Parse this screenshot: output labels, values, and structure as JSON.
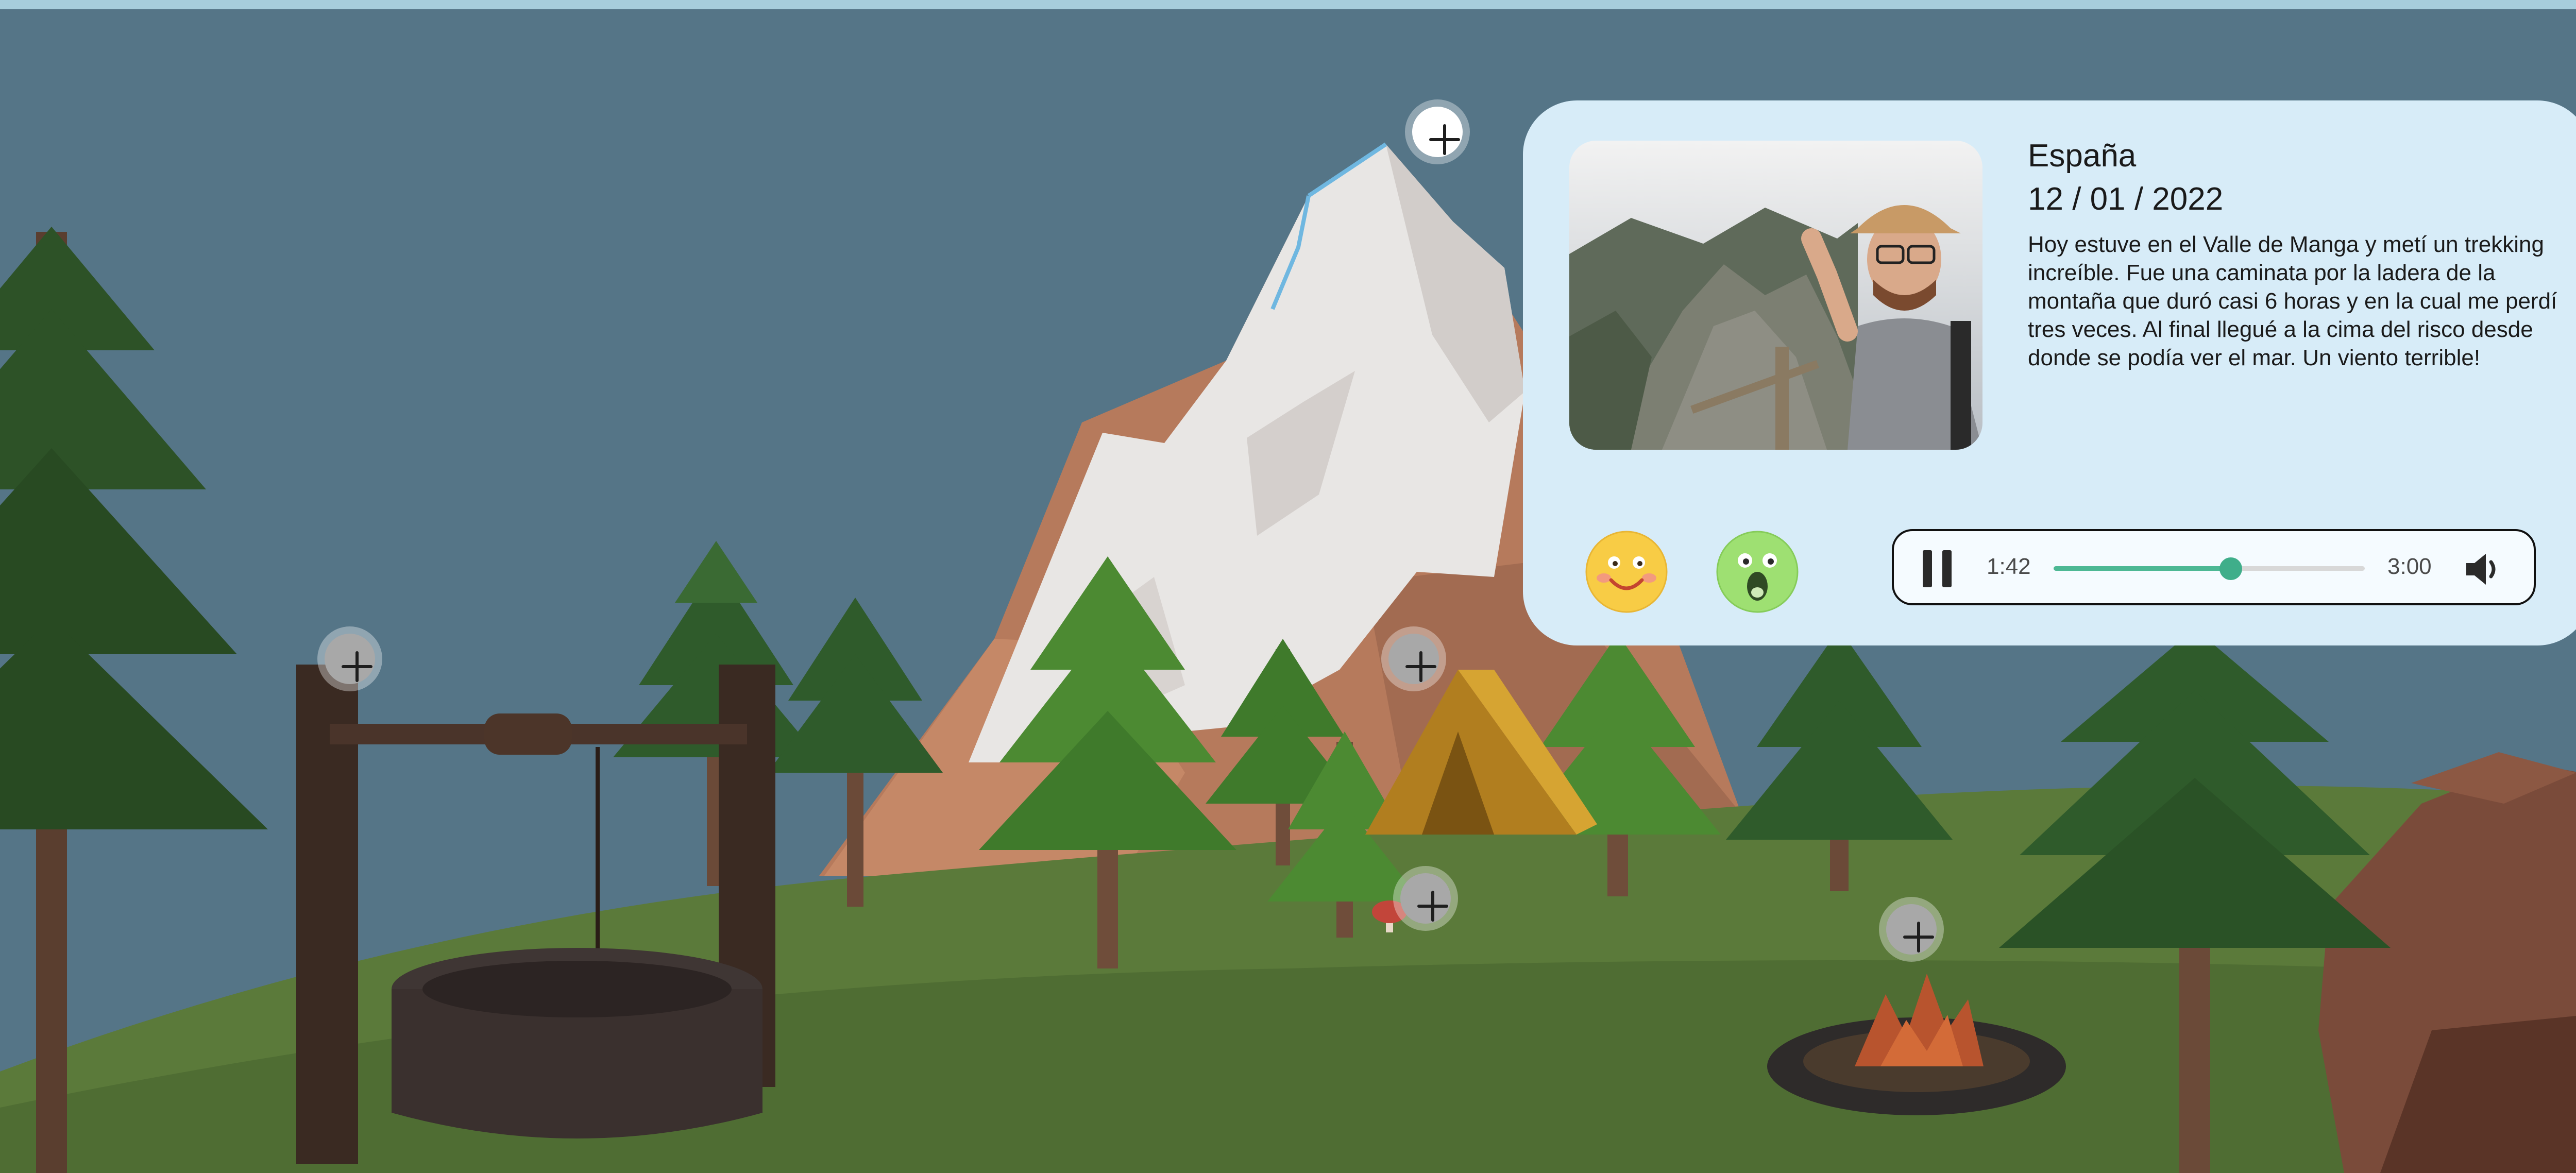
{
  "entry": {
    "country": "España",
    "date": "12 / 01 / 2022",
    "story": "Hoy estuve en el Valle de Manga y metí un trekking increíble. Fue una caminata por la ladera de la montaña que duró casi 6 horas y en la cual me perdí tres veces. Al final llegué a la cima del risco desde donde se podía ver el mar. Un viento terrible!"
  },
  "reactions": [
    {
      "name": "happy-face-icon",
      "color": "#f8cc45"
    },
    {
      "name": "shocked-face-icon",
      "color": "#9ee072"
    }
  ],
  "player": {
    "current_time": "1:42",
    "total_time": "3:00",
    "progress": 0.57,
    "state": "playing",
    "play_icon": "pause-icon",
    "volume_icon": "speaker-icon"
  },
  "hotspots": [
    {
      "name": "hotspot-mountain-peak",
      "icon": "plus-icon"
    },
    {
      "name": "hotspot-well",
      "icon": "plus-icon"
    },
    {
      "name": "hotspot-tent",
      "icon": "plus-icon"
    },
    {
      "name": "hotspot-mushroom",
      "icon": "plus-icon"
    },
    {
      "name": "hotspot-campfire",
      "icon": "plus-icon"
    }
  ],
  "colors": {
    "sky": "#557587",
    "card": "#d7ecf8",
    "accent": "#4cb894",
    "grass": "#5f7d3d"
  }
}
